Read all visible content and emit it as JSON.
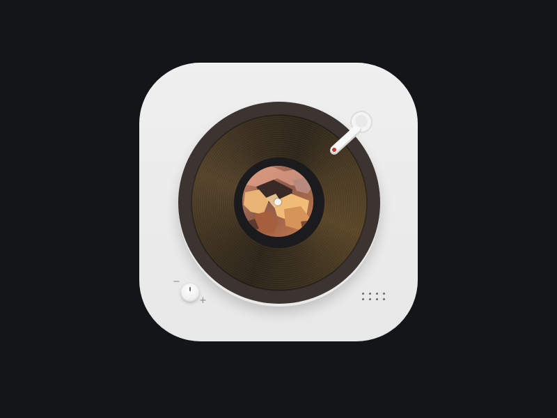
{
  "app_icon": {
    "name": "record-player-app-icon",
    "colors": {
      "background": "#121619",
      "icon_body": "#ececec",
      "platter": "#3b3431",
      "vinyl_tint": "#4a3a22",
      "label_ring": "#1b1b1d",
      "spindle": "#f4f4f4",
      "tonearm": "#f7f7f7",
      "needle_accent": "#c0392b"
    },
    "record": {
      "label_artwork": "album-art",
      "spindle_icon": "spindle-dot"
    },
    "tonearm": {
      "icon": "tonearm-icon"
    },
    "volume": {
      "minus_label": "−",
      "plus_label": "+",
      "knob_icon": "volume-knob-icon"
    },
    "speaker": {
      "icon": "speaker-grille-icon",
      "rows": 2,
      "columns": 4
    }
  }
}
